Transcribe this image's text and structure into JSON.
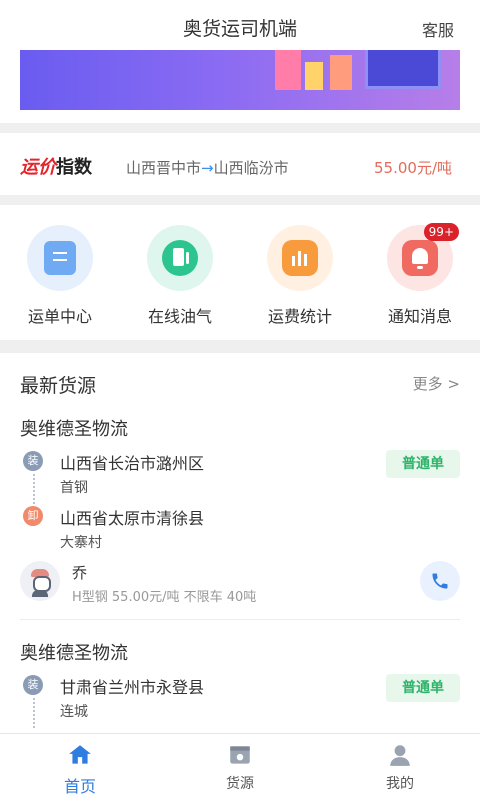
{
  "header": {
    "title": "奥货运司机端",
    "service_label": "客服"
  },
  "freight_index": {
    "logo_red": "运价",
    "logo_dark": "指数",
    "from": "山西晋中市",
    "arrow": "→",
    "to": "山西临汾市",
    "price": "55.00元/吨"
  },
  "quick_menu": [
    {
      "label": "运单中心",
      "icon": "waybill-icon"
    },
    {
      "label": "在线油气",
      "icon": "fuel-pump-icon"
    },
    {
      "label": "运费统计",
      "icon": "bar-chart-icon"
    },
    {
      "label": "通知消息",
      "icon": "bell-icon",
      "badge": "99+"
    }
  ],
  "latest": {
    "title": "最新货源",
    "more_label": "更多 >",
    "cards": [
      {
        "company": "奥维德圣物流",
        "load_tag": "装",
        "load_place": "山西省长治市潞州区",
        "load_detail": "首钢",
        "unload_tag": "卸",
        "unload_place": "山西省太原市清徐县",
        "unload_detail": "大寨村",
        "order_type": "普通单",
        "driver": "乔",
        "cargo_info": "H型钢 55.00元/吨 不限车 40吨"
      },
      {
        "company": "奥维德圣物流",
        "load_tag": "装",
        "load_place": "甘肃省兰州市永登县",
        "load_detail": "连城",
        "order_type": "普通单"
      }
    ]
  },
  "tabbar": [
    {
      "label": "首页",
      "icon": "home-icon",
      "active": true
    },
    {
      "label": "货源",
      "icon": "cargo-box-icon",
      "active": false
    },
    {
      "label": "我的",
      "icon": "user-icon",
      "active": false
    }
  ],
  "colors": {
    "accent": "#2f7de0",
    "price": "#e26b5b",
    "logo_red": "#e3242b",
    "tag_green_bg": "#e7f7ec",
    "tag_green_text": "#2fb36a",
    "badge": "#d9222a"
  }
}
